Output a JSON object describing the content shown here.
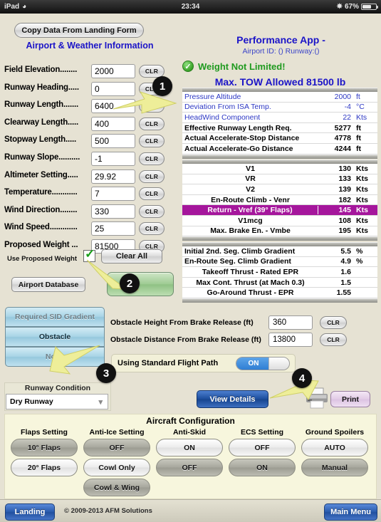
{
  "status_bar": {
    "device": "iPad",
    "wifi_icon": "wifi-icon",
    "time": "23:34",
    "bluetooth_icon": "bluetooth-icon",
    "battery_percent": "67%"
  },
  "header": {
    "copy_button": "Copy Data From Landing Form",
    "section_title": "Airport & Weather Information",
    "app_title": "Performance App -",
    "app_subtitle": "Airport ID: () Runway:()"
  },
  "airport_weather_form": {
    "fields": [
      {
        "label": "Field Elevation........",
        "value": "2000",
        "clear": "CLR"
      },
      {
        "label": "Runway Heading.....",
        "value": "0",
        "clear": "CLR"
      },
      {
        "label": "Runway Length.......",
        "value": "6400",
        "clear": "CLR"
      },
      {
        "label": "Clearway Length.....",
        "value": "400",
        "clear": "CLR"
      },
      {
        "label": "Stopway Length.....",
        "value": "500",
        "clear": "CLR"
      },
      {
        "label": "Runway Slope..........",
        "value": "-1",
        "clear": "CLR"
      },
      {
        "label": "Altimeter Setting.....",
        "value": "29.92",
        "clear": "CLR"
      },
      {
        "label": "Temperature............",
        "value": "7",
        "clear": "CLR"
      },
      {
        "label": "Wind Direction........",
        "value": "330",
        "clear": "CLR"
      },
      {
        "label": "Wind Speed.............",
        "value": "25",
        "clear": "CLR"
      },
      {
        "label": "Proposed Weight ...",
        "value": "81500",
        "clear": "CLR"
      }
    ],
    "use_proposed_weight_label": "Use Proposed Weight",
    "use_proposed_weight_checked": "✓",
    "clear_all_button": "Clear All",
    "airport_database_button": "Airport Database",
    "calculate_button": ""
  },
  "results": {
    "status_icon": "check-circle-icon",
    "status_text": "Weight Not Limited!",
    "max_tow_text": "Max. TOW Allowed  81500  lb",
    "rows_group1": [
      {
        "label": "Pressure Altitude",
        "value": "2000",
        "unit": "ft",
        "style": "blue"
      },
      {
        "label": "Deviation From ISA Temp.",
        "value": "-4",
        "unit": "°C",
        "style": "blue"
      },
      {
        "label": "HeadWind Component",
        "value": "22",
        "unit": "Kts",
        "style": "blue"
      },
      {
        "label": "Effective Runway Length Req.",
        "value": "5277",
        "unit": "ft",
        "style": "bold"
      },
      {
        "label": "Actual Accelerate-Stop Distance",
        "value": "4778",
        "unit": "ft",
        "style": "bold"
      },
      {
        "label": "Actual Accelerate-Go Distance",
        "value": "4244",
        "unit": "ft",
        "style": "bold"
      }
    ],
    "rows_group2": [
      {
        "label": "V1",
        "value": "130",
        "unit": "Kts",
        "style": "bold ctr"
      },
      {
        "label": "VR",
        "value": "133",
        "unit": "Kts",
        "style": "bold ctr"
      },
      {
        "label": "V2",
        "value": "139",
        "unit": "Kts",
        "style": "bold ctr"
      },
      {
        "label": "En-Route Climb - Venr",
        "value": "182",
        "unit": "Kts",
        "style": "bold ctr"
      },
      {
        "label": "Return - Vref (39° Flaps)",
        "value": "145",
        "unit": "Kts",
        "style": "hl ctr"
      },
      {
        "label": "V1mcg",
        "value": "108",
        "unit": "Kts",
        "style": "bold ctr"
      },
      {
        "label": "Max. Brake En. - Vmbe",
        "value": "195",
        "unit": "Kts",
        "style": "bold ctr"
      }
    ],
    "rows_group3": [
      {
        "label": "Initial 2nd. Seg. Climb Gradient",
        "value": "5.5",
        "unit": "%",
        "style": "bold"
      },
      {
        "label": "En-Route Seg. Climb Gradient",
        "value": "4.9",
        "unit": "%",
        "style": "bold"
      },
      {
        "label": "Takeoff Thrust - Rated EPR",
        "value": "1.6",
        "unit": "",
        "style": "bold ctr"
      },
      {
        "label": "Max Cont. Thrust (at Mach 0.3)",
        "value": "1.5",
        "unit": "",
        "style": "bold ctr"
      },
      {
        "label": "Go-Around Thrust - EPR",
        "value": "1.55",
        "unit": "",
        "style": "bold ctr"
      }
    ]
  },
  "obstacle_section": {
    "mode_buttons": [
      {
        "label": "Required SID Gradient",
        "selected": false
      },
      {
        "label": "Obstacle",
        "selected": true
      },
      {
        "label": "None",
        "selected": false
      }
    ],
    "height_label": "Obstacle Height From Brake Release (ft)",
    "height_value": "360",
    "height_clear": "CLR",
    "distance_label": "Obstacle Distance From Brake Release (ft)",
    "distance_value": "13800",
    "distance_clear": "CLR",
    "standard_flight_path_label": "Using Standard Flight Path",
    "standard_flight_path_state": "ON"
  },
  "runway_condition": {
    "title": "Runway Condition",
    "selected": "Dry Runway",
    "chevron_icon": "chevron-down-icon"
  },
  "actions": {
    "view_details": "View Details",
    "printer_icon": "printer-icon",
    "print": "Print"
  },
  "aircraft_configuration": {
    "title": "Aircraft Configuration",
    "columns": [
      {
        "heading": "Flaps Setting",
        "options": [
          {
            "label": "10° Flaps",
            "selected": true
          },
          {
            "label": "20° Flaps",
            "selected": false
          }
        ]
      },
      {
        "heading": "Anti-Ice Setting",
        "options": [
          {
            "label": "OFF",
            "selected": true
          },
          {
            "label": "Cowl Only",
            "selected": false
          },
          {
            "label": "Cowl & Wing",
            "selected": true
          }
        ]
      },
      {
        "heading": "Anti-Skid",
        "options": [
          {
            "label": "ON",
            "selected": false
          },
          {
            "label": "OFF",
            "selected": true
          }
        ]
      },
      {
        "heading": "ECS Setting",
        "options": [
          {
            "label": "OFF",
            "selected": false
          },
          {
            "label": "ON",
            "selected": true
          }
        ]
      },
      {
        "heading": "Ground Spoilers",
        "options": [
          {
            "label": "AUTO",
            "selected": false
          },
          {
            "label": "Manual",
            "selected": true
          }
        ]
      }
    ]
  },
  "footer": {
    "landing_button": "Landing",
    "copyright": "© 2009-2013 AFM Solutions",
    "main_menu_button": "Main Menu"
  },
  "annotations": {
    "markers": [
      "1",
      "2",
      "3",
      "4"
    ]
  },
  "colors": {
    "page_background": "#e6e2d3",
    "title_blue": "#1b14c8",
    "status_green": "#1f9a1f",
    "highlight_magenta": "#a5169c",
    "toggle_blue": "#2f7ed4",
    "arrow_yellow": "#eeee99"
  }
}
